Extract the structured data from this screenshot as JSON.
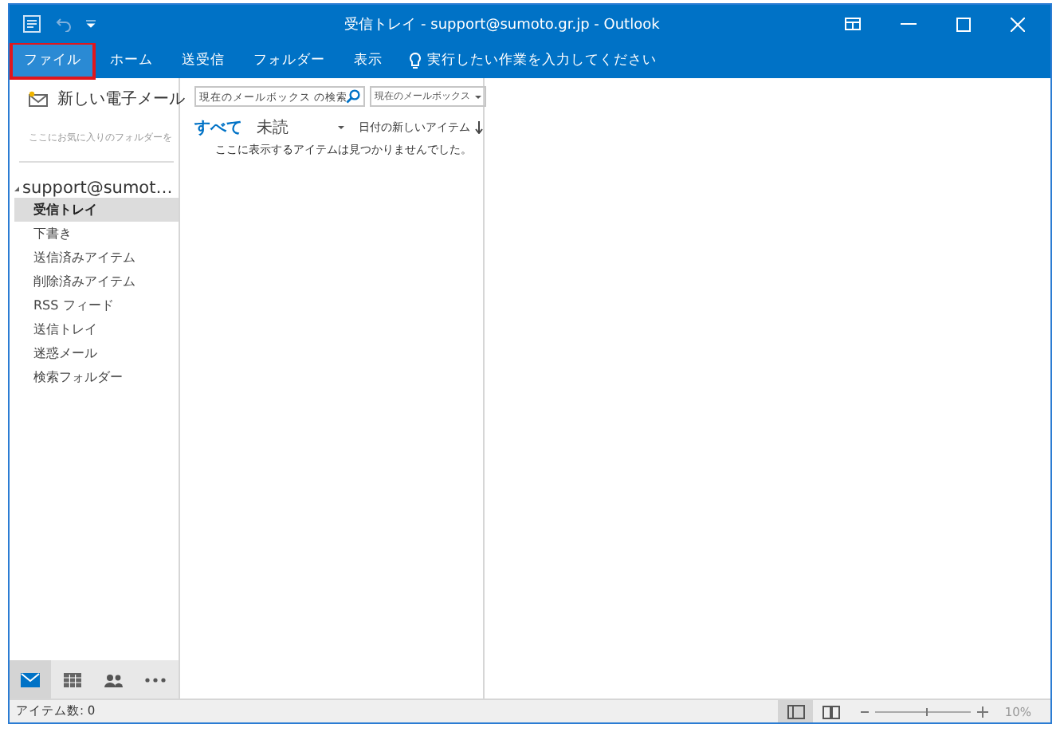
{
  "window": {
    "title": "受信トレイ - support@sumoto.gr.jp - Outlook"
  },
  "ribbon_tabs": [
    {
      "label": "ファイル",
      "selected": true,
      "highlighted": true
    },
    {
      "label": "ホーム",
      "selected": false,
      "highlighted": false
    },
    {
      "label": "送受信",
      "selected": false,
      "highlighted": false
    },
    {
      "label": "フォルダー",
      "selected": false,
      "highlighted": false
    },
    {
      "label": "表示",
      "selected": false,
      "highlighted": false
    }
  ],
  "tell_me": {
    "placeholder": "実行したい作業を入力してください"
  },
  "sidebar": {
    "new_mail": "新しい電子メール",
    "favorites_hint": "ここにお気に入りのフォルダーを",
    "account": "support@sumot…",
    "expanded": true,
    "folders": [
      {
        "label": "受信トレイ",
        "selected": true
      },
      {
        "label": "下書き",
        "selected": false
      },
      {
        "label": "送信済みアイテム",
        "selected": false
      },
      {
        "label": "削除済みアイテム",
        "selected": false
      },
      {
        "label": "RSS フィード",
        "selected": false
      },
      {
        "label": "送信トレイ",
        "selected": false
      },
      {
        "label": "迷惑メール",
        "selected": false
      },
      {
        "label": "検索フォルダー",
        "selected": false
      }
    ],
    "nav": [
      {
        "kind": "mail",
        "selected": true
      },
      {
        "kind": "calendar",
        "selected": false
      },
      {
        "kind": "people",
        "selected": false
      },
      {
        "kind": "more",
        "selected": false
      }
    ]
  },
  "message_list": {
    "search_placeholder": "現在のメールボックス の検索",
    "scope": "現在のメールボックス",
    "filters": [
      {
        "label": "すべて",
        "selected": true
      },
      {
        "label": "未読",
        "selected": false
      }
    ],
    "sort": "日付の新しいアイテム",
    "empty": "ここに表示するアイテムは見つかりませんでした。"
  },
  "status_bar": {
    "item_count": "アイテム数: 0",
    "zoom": {
      "level": 0.52,
      "reading": "10%"
    }
  }
}
